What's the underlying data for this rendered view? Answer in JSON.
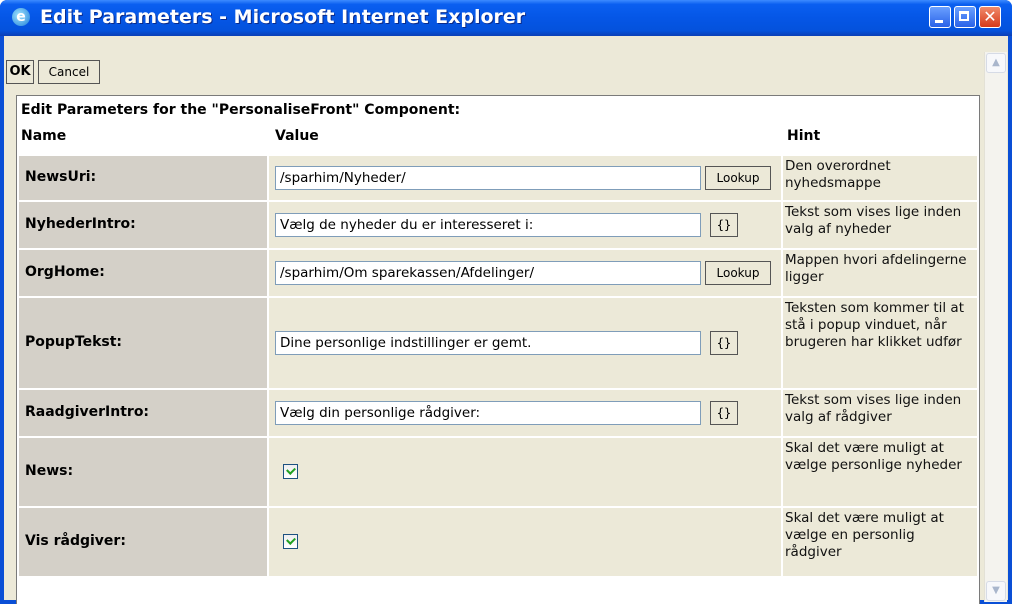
{
  "window": {
    "title": "Edit Parameters - Microsoft Internet Explorer"
  },
  "toolbar": {
    "ok_label": "OK",
    "cancel_label": "Cancel"
  },
  "panel": {
    "heading": "Edit Parameters for the \"PersonaliseFront\" Component:",
    "col_name": "Name",
    "col_value": "Value",
    "col_hint": "Hint"
  },
  "params": [
    {
      "name": "NewsUri:",
      "value": "/sparhim/Nyheder/",
      "button": "Lookup",
      "hint": "Den overordnet nyhedsmappe"
    },
    {
      "name": "NyhederIntro:",
      "value": "Vælg de nyheder du er interesseret i:",
      "button": "{}",
      "hint": "Tekst som vises lige inden valg af nyheder"
    },
    {
      "name": "OrgHome:",
      "value": "/sparhim/Om sparekassen/Afdelinger/",
      "button": "Lookup",
      "hint": "Mappen hvori afdelingerne ligger"
    },
    {
      "name": "PopupTekst:",
      "value": "Dine personlige indstillinger er gemt.",
      "button": "{}",
      "hint": "Teksten som kommer til at stå i popup vinduet, når brugeren har klikket udfør"
    },
    {
      "name": "RaadgiverIntro:",
      "value": "Vælg din personlige rådgiver:",
      "button": "{}",
      "hint": "Tekst som vises lige inden valg af rådgiver"
    },
    {
      "name": "News:",
      "checked": true,
      "hint": "Skal det være muligt at vælge personlige nyheder"
    },
    {
      "name": "Vis rådgiver:",
      "checked": true,
      "hint": "Skal det være muligt at vælge en personlig rådgiver"
    }
  ]
}
